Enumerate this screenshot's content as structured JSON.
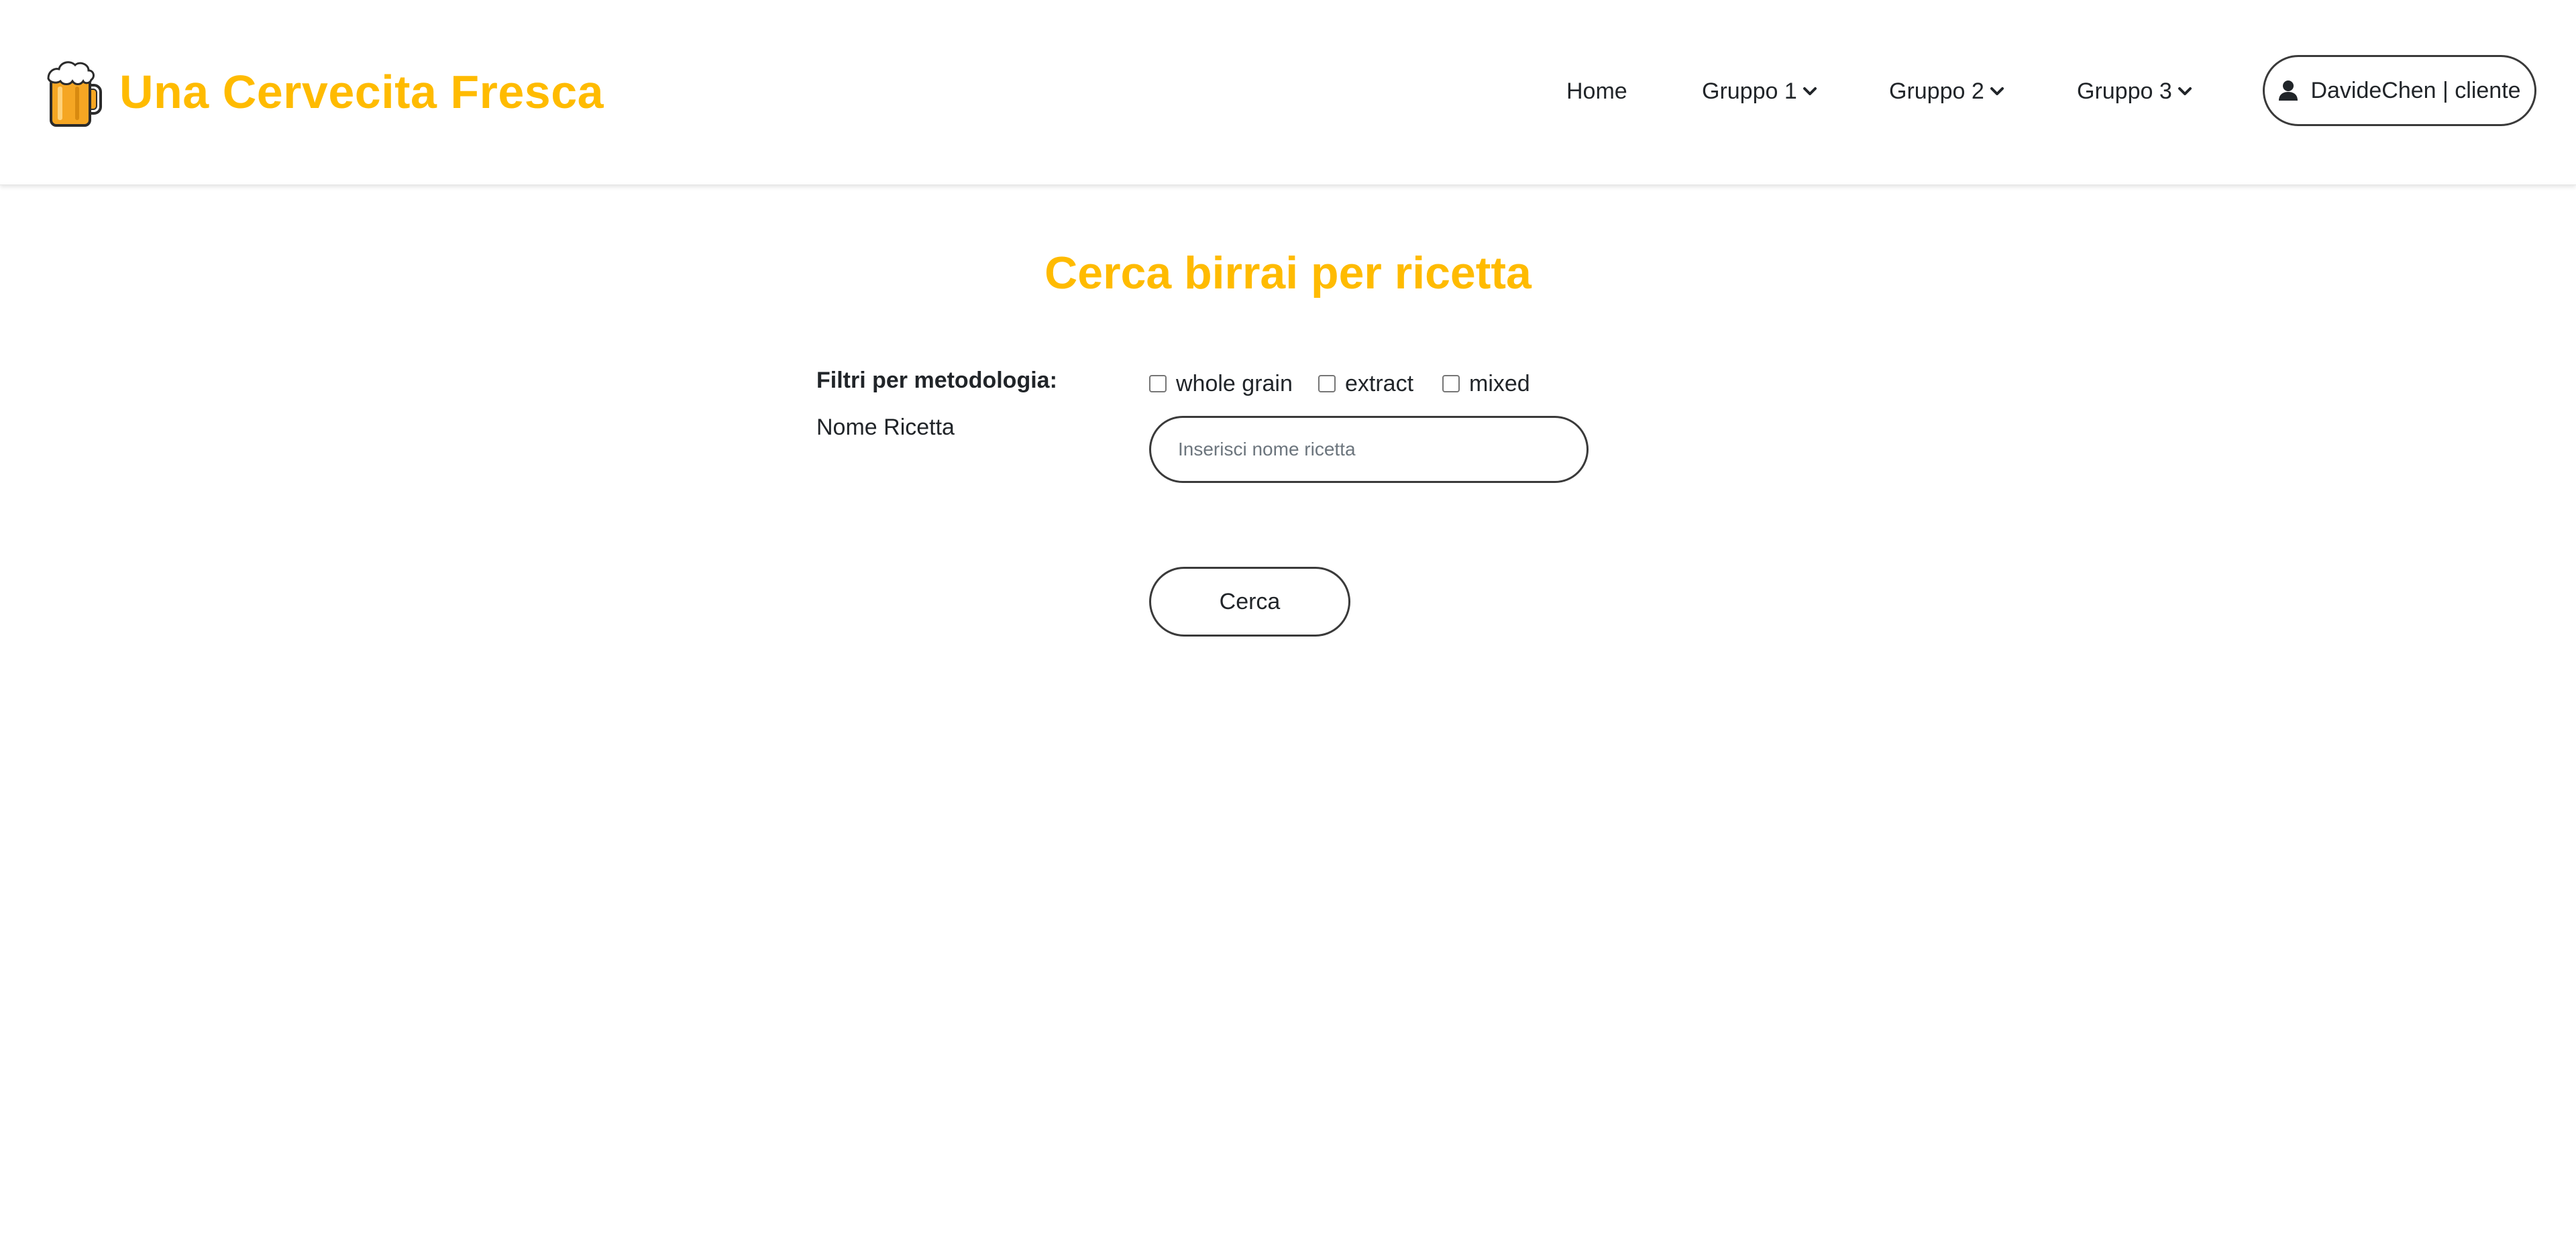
{
  "brand": {
    "title": "Una Cervecita Fresca",
    "logo_icon": "beer-mug-icon",
    "color": "#ffbb00"
  },
  "nav": {
    "home": "Home",
    "group1": "Gruppo 1",
    "group2": "Gruppo 2",
    "group3": "Gruppo 3",
    "dropdown_icon": "chevron-down-icon"
  },
  "user": {
    "label": "DavideChen | cliente",
    "icon": "user-icon"
  },
  "main": {
    "title": "Cerca birrai per ricetta",
    "filters_label": "Filtri per metodologia:",
    "filters": [
      {
        "label": "whole grain",
        "checked": false
      },
      {
        "label": "extract",
        "checked": false
      },
      {
        "label": "mixed",
        "checked": false
      }
    ],
    "name_label": "Nome Ricetta",
    "name_placeholder": "Inserisci nome ricetta",
    "name_value": "",
    "search_button": "Cerca"
  },
  "colors": {
    "accent": "#ffbb00",
    "text": "#212529",
    "border": "#3a3a3a"
  }
}
